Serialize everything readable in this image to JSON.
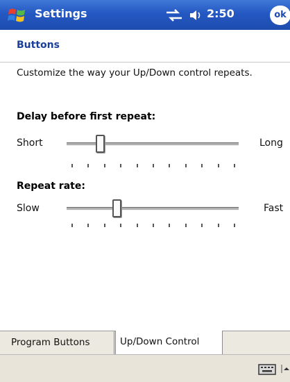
{
  "titlebar": {
    "app_title": "Settings",
    "time": "2:50",
    "ok_label": "ok"
  },
  "page": {
    "title": "Buttons",
    "description": "Customize the way your Up/Down control repeats."
  },
  "delay": {
    "title": "Delay before first repeat:",
    "min_label": "Short",
    "max_label": "Long",
    "value_fraction": 0.18,
    "tick_count": 11
  },
  "rate": {
    "title": "Repeat rate:",
    "min_label": "Slow",
    "max_label": "Fast",
    "value_fraction": 0.28,
    "tick_count": 11
  },
  "tabs": [
    {
      "label": "Program Buttons",
      "active": false
    },
    {
      "label": "Up/Down Control",
      "active": true
    }
  ],
  "icons": {
    "start": "windows-flag-icon",
    "connection": "connectivity-arrows-icon",
    "volume": "speaker-icon",
    "keyboard": "keyboard-icon",
    "input_menu": "arrow-up-icon"
  },
  "colors": {
    "titlebar": "#2458c2",
    "page_title": "#1a3f9a",
    "tab_strip": "#ece9e0"
  }
}
